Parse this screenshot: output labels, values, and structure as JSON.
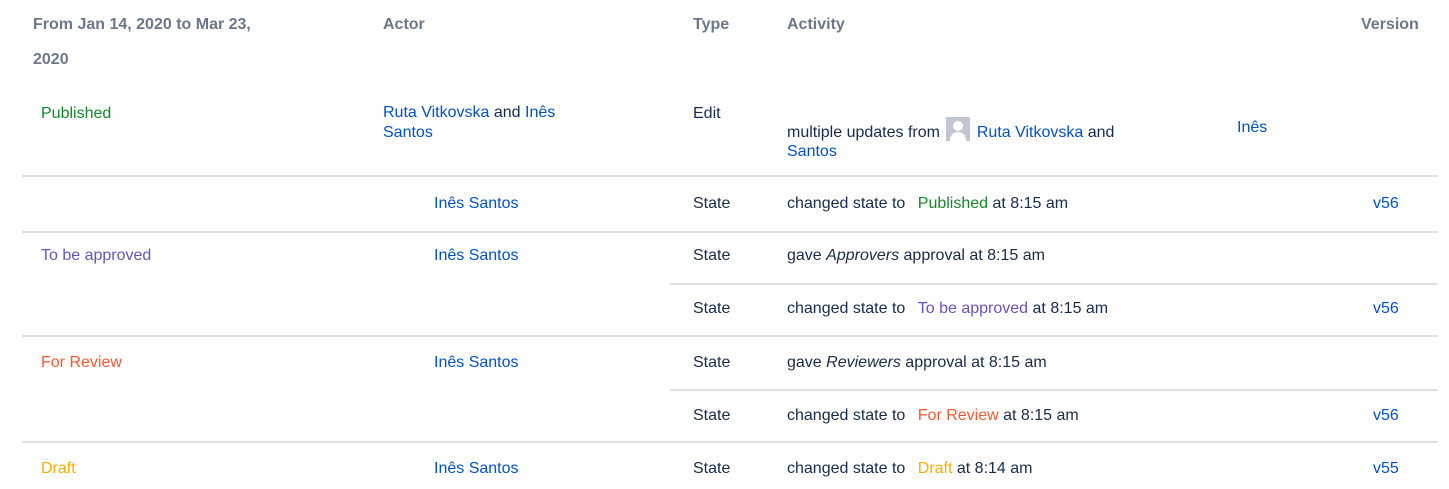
{
  "header": {
    "date_range_line1": "From Jan 14, 2020 to Mar 23,",
    "date_range_line2": "2020",
    "actor": "Actor",
    "type": "Type",
    "activity": "Activity",
    "version": "Version"
  },
  "colors": {
    "link": "#0052cc",
    "published": "#14892c",
    "to_be_approved": "#6554c0",
    "for_review": "#ff5630",
    "draft": "#ffab00",
    "header_text": "#6b778c",
    "divider": "#dfe1e6"
  },
  "rows": {
    "published_group": {
      "state": "Published",
      "edit": {
        "actor1": "Ruta Vitkovska",
        "and": "and",
        "actor2_line1": "Inês",
        "actor2_line2": "Santos",
        "type": "Edit",
        "activity_prefix": "multiple updates from",
        "avatar_icon": "user-avatar-icon",
        "activity_actor1": "Ruta Vitkovska",
        "activity_and": "and",
        "activity_actor2_line1": "Inês",
        "activity_actor2_line2": "Santos"
      },
      "state_change": {
        "actor": "Inês Santos",
        "type": "State",
        "prefix": "changed state to",
        "state": "Published",
        "suffix": "at 8:15 am",
        "version": "v56"
      }
    },
    "approve_group": {
      "state": "To be approved",
      "actor": "Inês Santos",
      "approval": {
        "type": "State",
        "prefix": "gave",
        "group": "Approvers",
        "suffix": "approval at 8:15 am"
      },
      "state_change": {
        "type": "State",
        "prefix": "changed state to",
        "state": "To be approved",
        "suffix": "at 8:15 am",
        "version": "v56"
      }
    },
    "review_group": {
      "state": "For Review",
      "actor": "Inês Santos",
      "approval": {
        "type": "State",
        "prefix": "gave",
        "group": "Reviewers",
        "suffix": "approval at 8:15 am"
      },
      "state_change": {
        "type": "State",
        "prefix": "changed state to",
        "state": "For Review",
        "suffix": "at 8:15 am",
        "version": "v56"
      }
    },
    "draft_group": {
      "state": "Draft",
      "actor": "Inês Santos",
      "state_change": {
        "type": "State",
        "prefix": "changed state to",
        "state": "Draft",
        "suffix": "at 8:14 am",
        "version": "v55"
      }
    }
  }
}
